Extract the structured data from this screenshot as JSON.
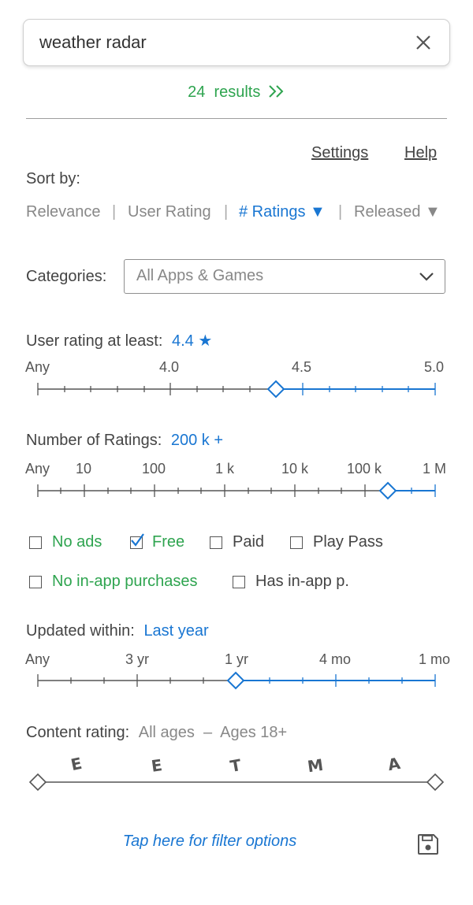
{
  "search": {
    "query": "weather radar",
    "clear_icon": "close-icon"
  },
  "results": {
    "count": "24",
    "label": "results",
    "icon": "double-chevron-right-icon"
  },
  "header_links": {
    "settings": "Settings",
    "help": "Help"
  },
  "sort": {
    "label": "Sort by:",
    "options": [
      "Relevance",
      "User Rating",
      "# Ratings ▼",
      "Released ▼"
    ],
    "active": "# Ratings ▼",
    "separator": "|"
  },
  "categories": {
    "label": "Categories:",
    "value": "All Apps & Games",
    "icon": "chevron-down-icon"
  },
  "user_rating": {
    "label": "User rating at least:",
    "value": "4.4 ★",
    "ticks": [
      "Any",
      "4.0",
      "4.5",
      "5.0"
    ]
  },
  "num_ratings": {
    "label": "Number of Ratings:",
    "value": "200 k +",
    "ticks": [
      "Any",
      "10",
      "100",
      "1 k",
      "10 k",
      "100 k",
      "1 M"
    ]
  },
  "filters": {
    "no_ads": "No ads",
    "free": "Free",
    "paid": "Paid",
    "play_pass": "Play Pass",
    "no_iap": "No in-app purchases",
    "has_iap": "Has in-app p."
  },
  "updated": {
    "label": "Updated within:",
    "value": "Last year",
    "ticks": [
      "Any",
      "3 yr",
      "1 yr",
      "4 mo",
      "1 mo"
    ]
  },
  "content_rating": {
    "label": "Content rating:",
    "range": "All ages  –  Ages 18+",
    "icons": [
      "E",
      "E",
      "T",
      "M",
      "A"
    ]
  },
  "footer": {
    "link": "Tap here for filter options",
    "save_icon": "save-icon"
  },
  "colors": {
    "accent": "#1976d2",
    "green": "#2ea44f",
    "muted": "#888888"
  }
}
